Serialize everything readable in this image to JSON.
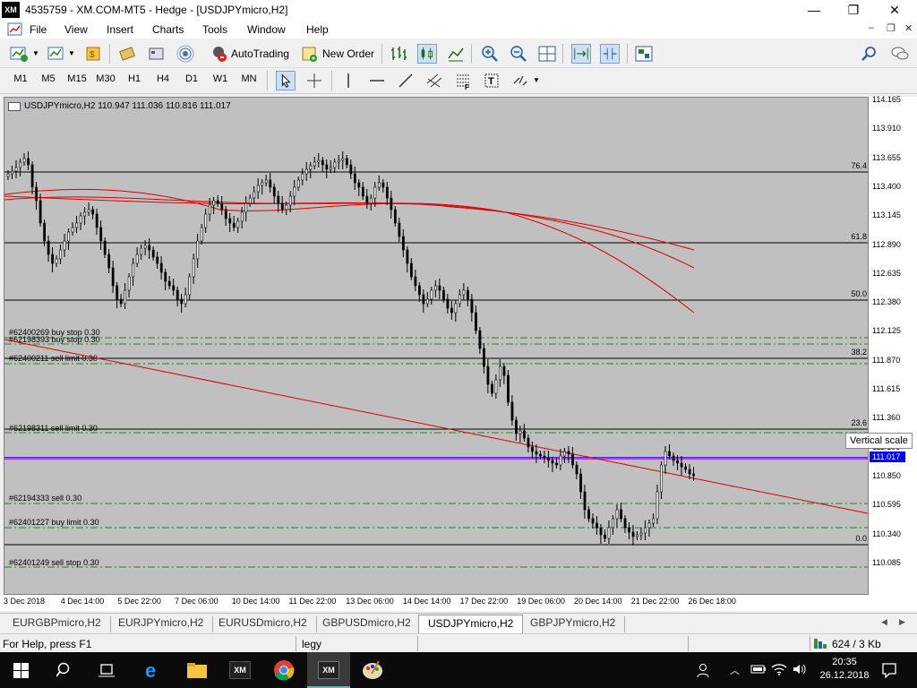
{
  "titlebar": {
    "logo": "XM",
    "title": "4535759 - XM.COM-MT5 - Hedge - [USDJPYmicro,H2]",
    "minimize": "—",
    "maximize": "❐",
    "close": "✕"
  },
  "menu": [
    "File",
    "View",
    "Insert",
    "Charts",
    "Tools",
    "Window",
    "Help"
  ],
  "toolbar": {
    "autotrading_label": "AutoTrading",
    "neworder_label": "New Order"
  },
  "timeframes": [
    "M1",
    "M5",
    "M15",
    "M30",
    "H1",
    "H4",
    "D1",
    "W1",
    "MN"
  ],
  "chart": {
    "header": "USDJPYmicro,H2  110.947 111.036 110.816 111.017",
    "current_price": "111.017",
    "tooltip": "Vertical scale",
    "price_labels": [
      "114.165",
      "113.910",
      "113.655",
      "113.400",
      "113.145",
      "112.890",
      "112.635",
      "112.380",
      "112.125",
      "111.870",
      "111.615",
      "111.360",
      "111.105",
      "110.850",
      "110.595",
      "110.340",
      "110.085"
    ],
    "time_labels": [
      "3 Dec 2018",
      "4 Dec 14:00",
      "5 Dec 22:00",
      "7 Dec 06:00",
      "10 Dec 14:00",
      "11 Dec 22:00",
      "13 Dec 06:00",
      "14 Dec 14:00",
      "17 Dec 22:00",
      "19 Dec 06:00",
      "20 Dec 14:00",
      "21 Dec 22:00",
      "26 Dec 18:00"
    ],
    "fib_levels": [
      "76.4",
      "61.8",
      "50.0",
      "38.2",
      "23.6",
      "0.0"
    ],
    "orders": [
      "#62400269 buy stop 0.30",
      "#62198393 buy stop 0.30",
      "#62400211 sell limit 0.30",
      "#62198311 sell limit 0.30",
      "#62194333 sell 0.30",
      "#62401227 buy limit 0.30",
      "#62401249 sell stop 0.30"
    ]
  },
  "tabs": [
    "EURGBPmicro,H2",
    "EURJPYmicro,H2",
    "EURUSDmicro,H2",
    "GBPUSDmicro,H2",
    "USDJPYmicro,H2",
    "GBPJPYmicro,H2"
  ],
  "status": {
    "help": "For Help, press F1",
    "profile": "legy",
    "traffic": "624 / 3 Kb"
  },
  "taskbar": {
    "time": "20:35",
    "date": "26.12.2018"
  },
  "colors": {
    "chart_bg": "#c0c0c0",
    "ma_line": "#e00000",
    "order_line": "#1a8a1a",
    "price_line": "#0000ff"
  }
}
